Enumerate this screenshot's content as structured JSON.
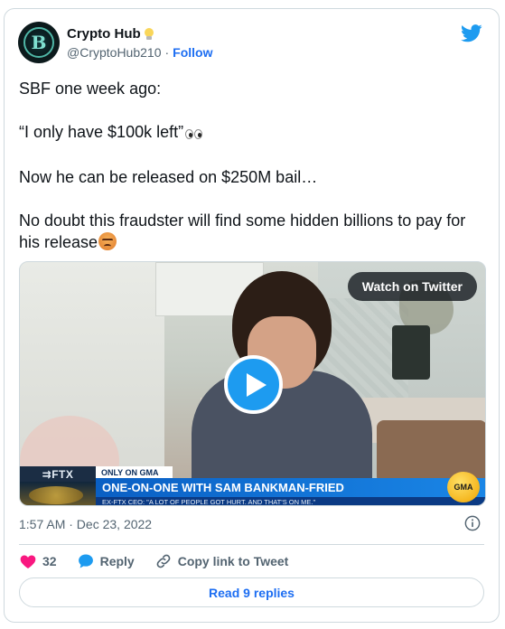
{
  "author": {
    "display_name": "Crypto Hub",
    "handle": "@CryptoHub210",
    "separator": "·",
    "follow_label": "Follow"
  },
  "tweet": {
    "lines": [
      "SBF one week ago:",
      "“I only have $100k left”",
      "Now he can be released on $250M bail…",
      "No doubt this fraudster will find some hidden billions to pay for his release"
    ],
    "emojis": [
      "eyes-emoji",
      "angry-face-emoji"
    ]
  },
  "media": {
    "watch_label": "Watch on Twitter",
    "ftx_label": "⇉FTX",
    "only_on": "ONLY ON GMA",
    "banner": "ONE-ON-ONE WITH SAM BANKMAN-FRIED",
    "subbanner": "EX-FTX CEO: \"A LOT OF PEOPLE GOT HURT. AND THAT'S ON ME.\"",
    "gma_logo": "GMA"
  },
  "meta": {
    "timestamp": "1:57 AM · Dec 23, 2022"
  },
  "actions": {
    "like_count": "32",
    "reply_label": "Reply",
    "copy_label": "Copy link to Tweet",
    "read_replies_label": "Read 9 replies"
  },
  "colors": {
    "twitter_blue": "#1d9bf0",
    "link_blue": "#1d6ef2",
    "like_red": "#f91880",
    "text_secondary": "#536471",
    "border": "#cfd9de"
  }
}
